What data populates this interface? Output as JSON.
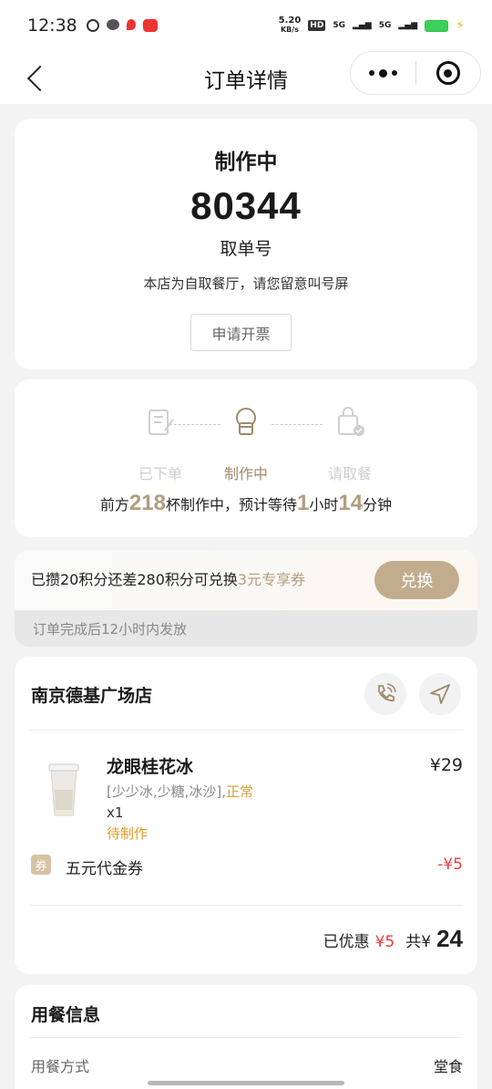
{
  "status_bar": {
    "time": "12:38",
    "speed": "5.20",
    "speed_unit": "KB/s",
    "hd": "HD",
    "net1": "5G",
    "net2": "5G"
  },
  "nav": {
    "title": "订单详情"
  },
  "order": {
    "status": "制作中",
    "pickup_number": "80344",
    "pickup_label": "取单号",
    "notice": "本店为自取餐厅，请您留意叫号屏",
    "invoice_button": "申请开票"
  },
  "progress": {
    "steps": [
      {
        "label": "已下单",
        "icon": "order-placed-icon",
        "active": false
      },
      {
        "label": "制作中",
        "icon": "chef-hat-icon",
        "active": true
      },
      {
        "label": "请取餐",
        "icon": "pickup-bag-icon",
        "active": false
      }
    ],
    "wait_prefix": "前方",
    "cups_ahead": "218",
    "wait_middle": "杯制作中，预计等待",
    "hours": "1",
    "hours_unit": "小时",
    "minutes": "14",
    "minutes_unit": "分钟"
  },
  "points": {
    "text_prefix": "已攒20积分还差280积分可兑换",
    "coupon_text": "3元专享券",
    "exchange_button": "兑换",
    "footer": "订单完成后12小时内发放"
  },
  "store": {
    "name": "南京德基广场店",
    "call_icon": "phone-call-icon",
    "navigate_icon": "navigation-arrow-icon"
  },
  "product": {
    "name": "龙眼桂花冰",
    "price": "¥29",
    "spec_main": "[少少冰,少糖,冰沙],",
    "spec_extra": "正常",
    "qty": "x1",
    "state": "待制作"
  },
  "coupon": {
    "tag": "券",
    "name": "五元代金券",
    "amount": "-¥5"
  },
  "total": {
    "discount_label": "已优惠",
    "discount_value": "¥5",
    "total_label": "共¥",
    "total_value": "24"
  },
  "dine": {
    "title": "用餐信息",
    "method_label": "用餐方式",
    "method_value": "堂食"
  },
  "colors": {
    "accent": "#b39c7e",
    "button": "#c2ac8e",
    "red": "#e5403c",
    "orange": "#e09a26"
  }
}
